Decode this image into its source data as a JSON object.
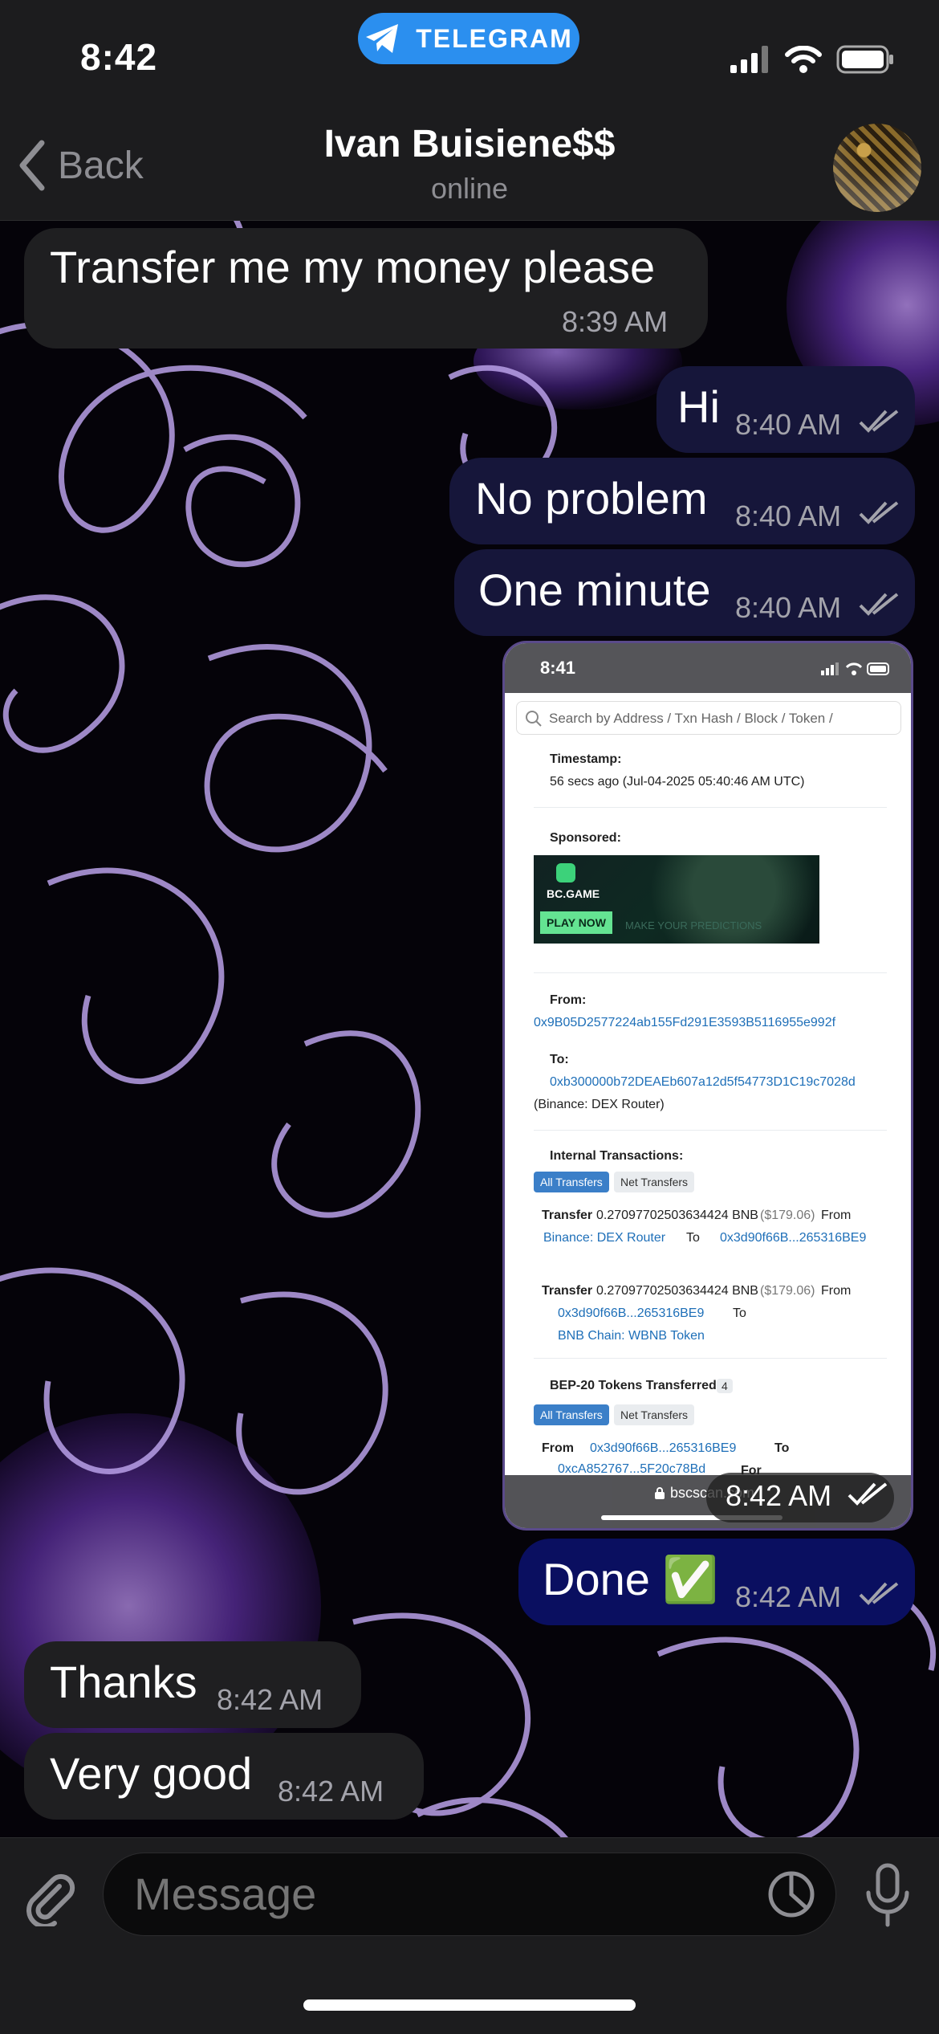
{
  "status_bar": {
    "time": "8:42",
    "app_pill": "TELEGRAM"
  },
  "header": {
    "back_label": "Back",
    "contact_name": "Ivan Buisiene$$",
    "contact_status": "online"
  },
  "messages": [
    {
      "direction": "incoming",
      "text": "Transfer me my money please",
      "time": "8:39 AM"
    },
    {
      "direction": "outgoing",
      "text": "Hi",
      "time": "8:40 AM"
    },
    {
      "direction": "outgoing",
      "text": "No problem",
      "time": "8:40 AM"
    },
    {
      "direction": "outgoing",
      "text": "One minute",
      "time": "8:40 AM"
    },
    {
      "direction": "outgoing",
      "type": "image",
      "time": "8:42 AM"
    },
    {
      "direction": "outgoing",
      "text": "Done ✅",
      "time": "8:42 AM"
    },
    {
      "direction": "incoming",
      "text": "Thanks",
      "time": "8:42 AM"
    },
    {
      "direction": "incoming",
      "text": "Very good",
      "time": "8:42 AM"
    }
  ],
  "screenshot": {
    "time": "8:41",
    "search_placeholder": "Search by Address / Txn Hash / Block / Token /",
    "timestamp_label": "Timestamp:",
    "timestamp_value": "56 secs ago (Jul-04-2025 05:40:46 AM UTC)",
    "sponsored_label": "Sponsored:",
    "ad_brand": "BC.GAME",
    "ad_button": "PLAY NOW",
    "ad_tagline": "MAKE YOUR PREDICTIONS",
    "from_label": "From:",
    "from_address": "0x9B05D2577224ab155Fd291E3593B5116955e992f",
    "to_label": "To:",
    "to_address": "0xb300000b72DEAEb607a12d5f54773D1C19c7028d",
    "to_name": "(Binance: DEX Router)",
    "internal_label": "Internal Transactions:",
    "all_transfers": "All Transfers",
    "net_transfers": "Net Transfers",
    "transfer_word": "Transfer",
    "transfer1_amount": "0.27097702503634424 BNB",
    "transfer1_usd": "($179.06)",
    "from_word": "From",
    "to_word": "To",
    "transfer1_from": "Binance: DEX Router",
    "transfer1_to": "0x3d90f66B...265316BE9",
    "transfer2_amount": "0.27097702503634424 BNB",
    "transfer2_usd": "($179.06)",
    "transfer2_from": "0x3d90f66B...265316BE9",
    "transfer2_to": "BNB Chain: WBNB Token",
    "bep20_label": "BEP-20 Tokens Transferred:",
    "bep20_count": "4",
    "bep20_from": "0x3d90f66B...265316BE9",
    "bep20_to": "0xcA852767...5F20c78Bd",
    "bep20_for": "For",
    "domain_label": "bscscan.com"
  },
  "input": {
    "placeholder": "Message"
  },
  "colors": {
    "incoming_bubble": "#1f1f21",
    "outgoing_bubble": "#16163a",
    "telegram_blue": "#2b8fef",
    "link_blue": "#1e6fb8"
  }
}
